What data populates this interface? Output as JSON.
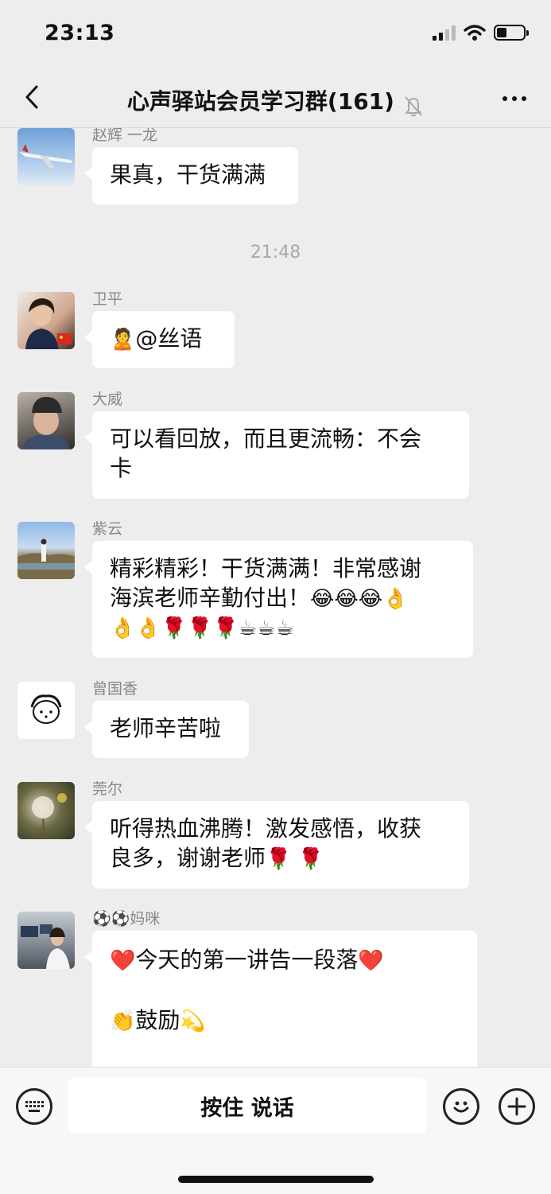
{
  "status_bar": {
    "time": "23:13"
  },
  "header": {
    "title": "心声驿站会员学习群(161)"
  },
  "timestamp": "21:48",
  "messages": [
    {
      "sender": "赵辉 一龙",
      "text": "果真，干货满满"
    },
    {
      "sender": "卫平",
      "emoji": "🙎",
      "text": "@丝语"
    },
    {
      "sender": "大威",
      "text_line1": "可以看回放，而且更流畅：不会",
      "text_line2": "卡"
    },
    {
      "sender": "紫云",
      "text_line1": "精彩精彩！干货满满！非常感谢",
      "text_line2": "海滨老师辛勤付出！",
      "emojis_line2": "😂😂😂👌",
      "emojis_line3": "👌👌🌹🌹🌹☕☕☕"
    },
    {
      "sender": "曾国香",
      "text": "老师辛苦啦"
    },
    {
      "sender": "莞尔",
      "text_line1": "听得热血沸腾！激发感悟，收获",
      "text_line2": "良多，谢谢老师",
      "emojis_line2": "🌹 🌹"
    },
    {
      "sender": "⚽⚽妈咪",
      "heart": "❤️",
      "text_line1": "今天的第一讲告一段落",
      "clap": "👏",
      "text_line2": "鼓励",
      "sparkle": "💫"
    }
  ],
  "input_bar": {
    "voice_label": "按住 说话"
  },
  "colors": {
    "background": "#ededed",
    "bubble": "#ffffff",
    "secondary_text": "#888888"
  }
}
